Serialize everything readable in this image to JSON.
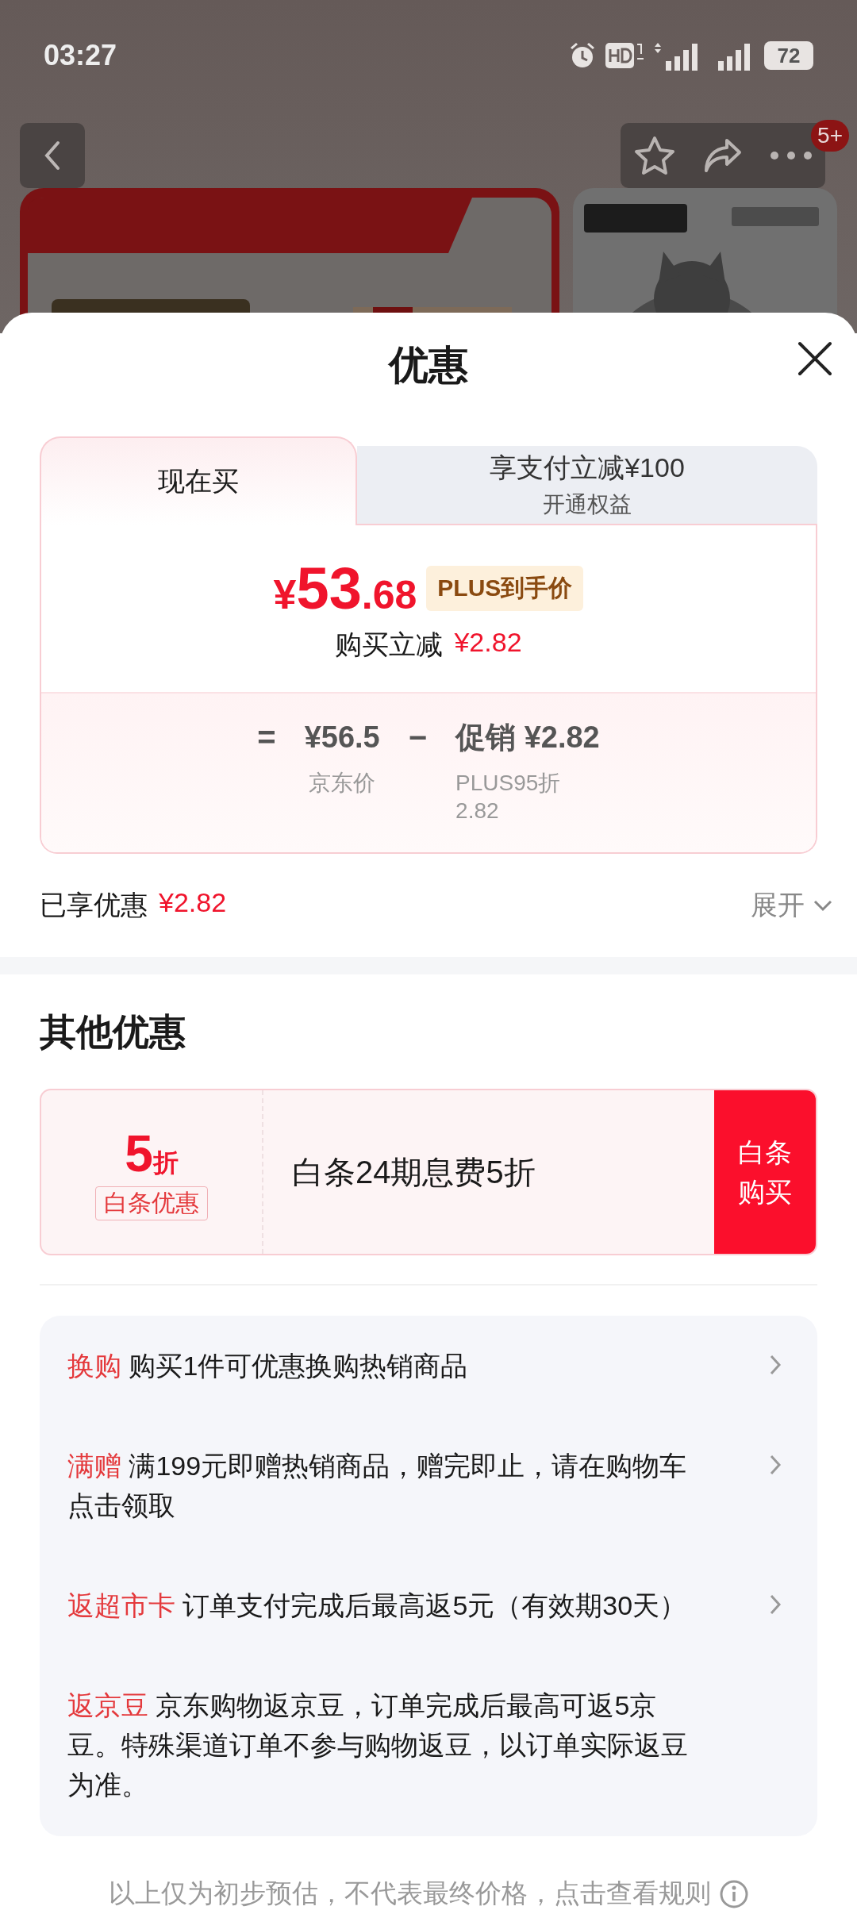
{
  "status_bar": {
    "time": "03:27",
    "battery": "72"
  },
  "nav": {
    "badge": "5+"
  },
  "sheet": {
    "title": "优惠",
    "tabs": [
      {
        "label": "现在买",
        "selected": true
      },
      {
        "label": "享支付立减¥100",
        "sublabel": "开通权益",
        "selected": false
      }
    ],
    "price": {
      "currency": "¥",
      "integer": "53",
      "decimal": ".68",
      "tag": "PLUS到手价"
    },
    "saving": {
      "label": "购买立减",
      "amount": "¥2.82"
    },
    "breakdown": {
      "equals": "=",
      "base_value": "¥56.5",
      "base_label": "京东价",
      "minus": "−",
      "promo_name": "促销",
      "promo_value": "¥2.82",
      "promo_label": "PLUS95折",
      "promo_sublabel": "2.82"
    },
    "enjoyed": {
      "label": "已享优惠",
      "amount": "¥2.82"
    },
    "expand": "展开"
  },
  "other": {
    "title": "其他优惠",
    "coupon": {
      "discount": "5",
      "unit": "折",
      "tag": "白条优惠",
      "text": "白条24期息费5折",
      "button": "白条购买"
    },
    "offers": [
      {
        "tag": "换购",
        "text": "购买1件可优惠换购热销商品",
        "arrow": true
      },
      {
        "tag": "满赠",
        "text": "满199元即赠热销商品，赠完即止，请在购物车点击领取",
        "arrow": true
      },
      {
        "tag": "返超市卡",
        "text": "订单支付完成后最高返5元（有效期30天）",
        "arrow": true
      },
      {
        "tag": "返京豆",
        "text": "京东购物返京豆，订单完成后最高可返5京豆。特殊渠道订单不参与购物返豆，以订单实际返豆为准。",
        "arrow": false
      }
    ],
    "footer": "以上仅为初步预估，不代表最终价格，点击查看规则"
  }
}
